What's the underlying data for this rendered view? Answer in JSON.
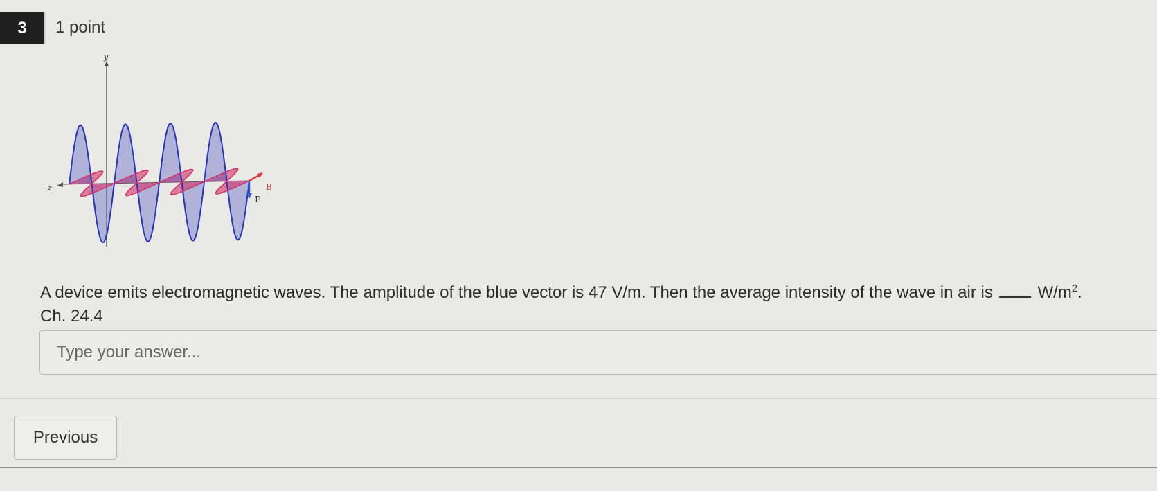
{
  "question": {
    "number": "3",
    "points": "1 point",
    "text_before_blank": "A device emits electromagnetic waves. The amplitude of the blue vector is 47 V/m. Then the average intensity of the wave in air is",
    "unit_base": "W/m",
    "unit_exponent": "2",
    "unit_end": ".",
    "reference": "Ch. 24.4"
  },
  "figure": {
    "axis_y": "y",
    "axis_z": "z",
    "vector_b": "B",
    "vector_e": "E",
    "colors": {
      "electric": "#2b35b8",
      "magnetic": "#d2336a",
      "arrow_b": "#d63a3a",
      "arrow_e": "#2f5fd0"
    }
  },
  "answer": {
    "placeholder": "Type your answer...",
    "value": ""
  },
  "nav": {
    "previous_label": "Previous"
  }
}
